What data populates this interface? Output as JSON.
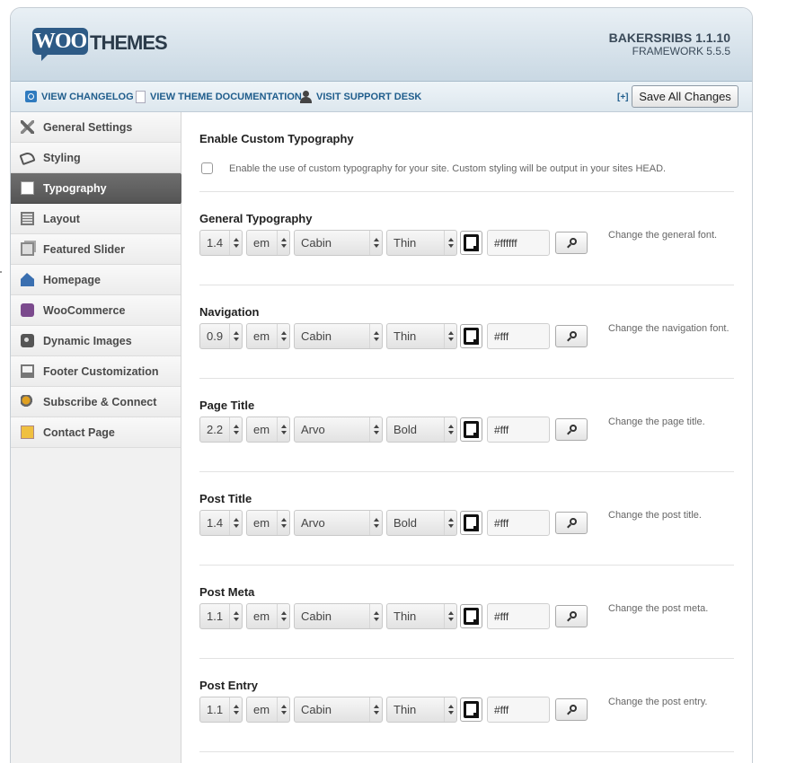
{
  "header": {
    "logo_woo": "WOO",
    "logo_themes": "THEMES",
    "theme_name": "BAKERSRIBS 1.1.10",
    "framework": "FRAMEWORK 5.5.5"
  },
  "toolbar": {
    "changelog": "VIEW CHANGELOG",
    "documentation": "VIEW THEME DOCUMENTATION",
    "support": "VISIT SUPPORT DESK",
    "expand": "[+]",
    "save_label": "Save All Changes"
  },
  "sidebar": {
    "items": [
      {
        "label": "General Settings",
        "icon": "tools-icon"
      },
      {
        "label": "Styling",
        "icon": "paint-bucket-icon"
      },
      {
        "label": "Typography",
        "icon": "typography-icon",
        "active": true
      },
      {
        "label": "Layout",
        "icon": "layout-icon"
      },
      {
        "label": "Featured Slider",
        "icon": "slider-icon"
      },
      {
        "label": "Homepage",
        "icon": "home-icon"
      },
      {
        "label": "WooCommerce",
        "icon": "woocommerce-icon"
      },
      {
        "label": "Dynamic Images",
        "icon": "camera-icon"
      },
      {
        "label": "Footer Customization",
        "icon": "footer-icon"
      },
      {
        "label": "Subscribe & Connect",
        "icon": "subscribe-icon"
      },
      {
        "label": "Contact Page",
        "icon": "contact-icon"
      }
    ]
  },
  "main": {
    "enable": {
      "title": "Enable Custom Typography",
      "desc": "Enable the use of custom typography for your site. Custom styling will be output in your sites HEAD.",
      "checked": false
    },
    "options": [
      {
        "title": "General Typography",
        "size": "1.4",
        "unit": "em",
        "font": "Cabin",
        "weight": "Thin",
        "color": "#ffffff",
        "desc": "Change the general font."
      },
      {
        "title": "Navigation",
        "size": "0.9",
        "unit": "em",
        "font": "Cabin",
        "weight": "Thin",
        "color": "#fff",
        "desc": "Change the navigation font."
      },
      {
        "title": "Page Title",
        "size": "2.2",
        "unit": "em",
        "font": "Arvo",
        "weight": "Bold",
        "color": "#fff",
        "desc": "Change the page title."
      },
      {
        "title": "Post Title",
        "size": "1.4",
        "unit": "em",
        "font": "Arvo",
        "weight": "Bold",
        "color": "#fff",
        "desc": "Change the post title."
      },
      {
        "title": "Post Meta",
        "size": "1.1",
        "unit": "em",
        "font": "Cabin",
        "weight": "Thin",
        "color": "#fff",
        "desc": "Change the post meta."
      },
      {
        "title": "Post Entry",
        "size": "1.1",
        "unit": "em",
        "font": "Cabin",
        "weight": "Thin",
        "color": "#fff",
        "desc": "Change the post entry."
      }
    ]
  }
}
